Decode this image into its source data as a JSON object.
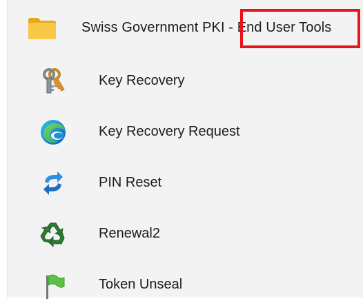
{
  "folder": {
    "label": "Swiss Government PKI - End User Tools",
    "icon": "folder-icon"
  },
  "items": [
    {
      "label": "Key Recovery",
      "icon": "keys-icon"
    },
    {
      "label": "Key Recovery Request",
      "icon": "edge-browser-icon"
    },
    {
      "label": "PIN Reset",
      "icon": "refresh-arrows-icon"
    },
    {
      "label": "Renewal2",
      "icon": "recycle-icon"
    },
    {
      "label": "Token Unseal",
      "icon": "flag-icon"
    }
  ],
  "colors": {
    "highlight": "#e8141b",
    "folder": "#f6c343",
    "panel_background": "#f3f3f3"
  }
}
